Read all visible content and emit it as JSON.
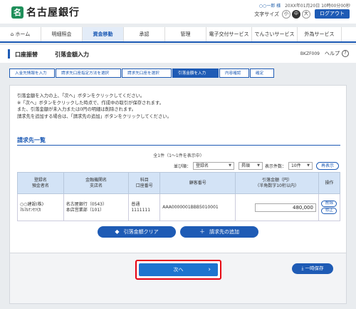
{
  "header": {
    "bank_name": "名古屋銀行",
    "logo_mark": "名",
    "user_name": "○○一郎 様",
    "last_login": "20XX年01月20日 10時00分00秒",
    "font_size_label": "文字サイズ",
    "font_sizes": [
      "小",
      "中",
      "大"
    ],
    "font_size_selected": "中",
    "logout_label": "ログアウト"
  },
  "gnav": {
    "items": [
      {
        "label": "ホーム",
        "icon": "home-icon"
      },
      {
        "label": "明細照会"
      },
      {
        "label": "資金移動",
        "active": true
      },
      {
        "label": "承認"
      },
      {
        "label": "管理"
      },
      {
        "label": "電子交付サービス"
      },
      {
        "label": "でんさいサービス"
      },
      {
        "label": "外為サービス"
      }
    ]
  },
  "titlebar": {
    "category": "口座振替",
    "title": "引落金額入力",
    "screen_id": "BKZF009",
    "help_label": "ヘルプ",
    "help_icon": "?"
  },
  "steps": [
    {
      "label": "入金先情報を入力"
    },
    {
      "label": "請求先口座指定方法を選択"
    },
    {
      "label": "請求先口座を選択"
    },
    {
      "label": "引落金額を入力",
      "current": true
    },
    {
      "label": "内容確認"
    },
    {
      "label": "確定"
    }
  ],
  "message": {
    "lines": [
      "引落金額を入力の上、「次へ」ボタンをクリックしてください。",
      "※「次へ」ボタンをクリックした時点で、作成中の取引が保存されます。",
      "また、引落金額が未入力または0円の明細は削除されます。",
      "請求先を追加する場合は、「請求先の追加」ボタンをクリックしてください。"
    ]
  },
  "list": {
    "section_title": "請求先一覧",
    "count_text": "全1件（1～1件を表示中）",
    "sort_label": "並び順：",
    "sort_value": "登録名",
    "order_value": "昇順",
    "per_page_label": "表示件数：",
    "per_page_value": "10件",
    "redisplay_label": "再表示",
    "headers": [
      [
        "登録名",
        "預金者名"
      ],
      [
        "金融機関名",
        "支店名"
      ],
      [
        "科目",
        "口座番号"
      ],
      [
        "顧客番号"
      ],
      [
        "引落金額（円）",
        "（半角数字10桁以内）"
      ],
      [
        "操作"
      ]
    ],
    "rows": [
      {
        "reg_name": "○○建設(株)",
        "holder_name": "ﾏﾙﾏﾙｹﾝｾﾂ(ｶ",
        "bank_name": "名古屋銀行（0543）",
        "branch_name": "本店営業部（101）",
        "account_type": "普通",
        "account_no": "1111111",
        "customer_no": "AAA0000001BBB5010001",
        "amount": "480,000",
        "delete_label": "削除",
        "edit_label": "修正"
      }
    ]
  },
  "buttons": {
    "clear_label": "引落金額クリア",
    "add_label": "請求先の追加",
    "next_label": "次へ",
    "temp_save_label": "一時保存"
  },
  "colors": {
    "primary": "#1e5bb5",
    "next_button": "#1e74cf",
    "highlight_frame": "#e60012",
    "table_header": "#d3e3f6",
    "brand_green": "#1f8f5a"
  }
}
